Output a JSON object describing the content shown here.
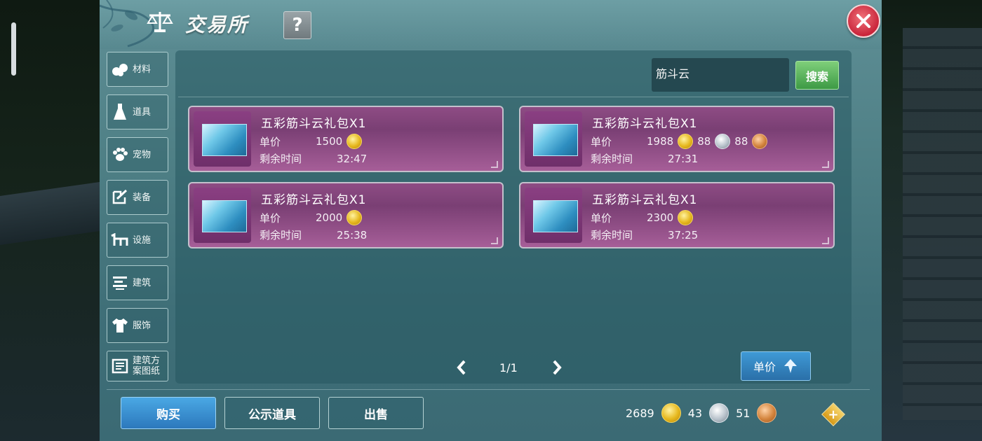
{
  "header": {
    "title": "交易所",
    "help_label": "?"
  },
  "categories": [
    {
      "label": "材料",
      "icon": "materials-icon"
    },
    {
      "label": "道具",
      "icon": "potion-icon"
    },
    {
      "label": "宠物",
      "icon": "paw-icon"
    },
    {
      "label": "装备",
      "icon": "equipment-icon"
    },
    {
      "label": "设施",
      "icon": "facility-icon"
    },
    {
      "label": "建筑",
      "icon": "building-icon"
    },
    {
      "label": "服饰",
      "icon": "clothing-icon"
    },
    {
      "label": "建筑方案图纸",
      "label_line1": "建筑方",
      "label_line2": "案图纸",
      "icon": "blueprint-icon"
    }
  ],
  "search": {
    "value": "筋斗云",
    "button_label": "搜索"
  },
  "listings": [
    {
      "name": "五彩筋斗云礼包X1",
      "price_key": "单价",
      "price": "1500",
      "time_key": "剩余时间",
      "time": "32:47"
    },
    {
      "name": "五彩筋斗云礼包X1",
      "price_key": "单价",
      "price": "1988",
      "price_silver": "88",
      "price_copper": "88",
      "time_key": "剩余时间",
      "time": "27:31"
    },
    {
      "name": "五彩筋斗云礼包X1",
      "price_key": "单价",
      "price": "2000",
      "time_key": "剩余时间",
      "time": "25:38"
    },
    {
      "name": "五彩筋斗云礼包X1",
      "price_key": "单价",
      "price": "2300",
      "time_key": "剩余时间",
      "time": "37:25"
    }
  ],
  "pagination": {
    "text": "1/1"
  },
  "sort": {
    "label": "单价"
  },
  "footer": {
    "buy_label": "购买",
    "showcase_label": "公示道具",
    "sell_label": "出售"
  },
  "wallet": {
    "gold": "2689",
    "silver": "43",
    "copper": "51"
  },
  "colors": {
    "panel": "#4f8086",
    "card": "#8e4c84",
    "accent_blue": "#2c78bc",
    "search_green": "#3d9a45",
    "close_red": "#c9243a"
  }
}
